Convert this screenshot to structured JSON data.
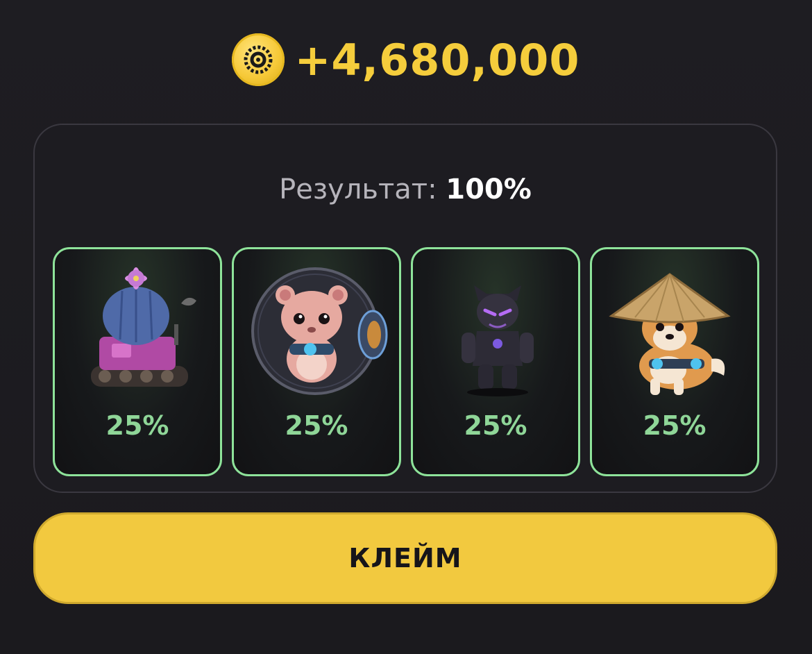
{
  "reward": {
    "coin_icon": "coin-icon",
    "amount": "+4,680,000",
    "color": "#f5cd3c"
  },
  "result": {
    "label": "Результат:",
    "value": "100%"
  },
  "cards": [
    {
      "icon": "cactus-tank-icon",
      "percent": "25%"
    },
    {
      "icon": "hamster-ball-icon",
      "percent": "25%"
    },
    {
      "icon": "panther-robot-icon",
      "percent": "25%"
    },
    {
      "icon": "shiba-hat-icon",
      "percent": "25%"
    }
  ],
  "claim_button": {
    "label": "КЛЕЙМ",
    "color": "#f2c93f"
  }
}
